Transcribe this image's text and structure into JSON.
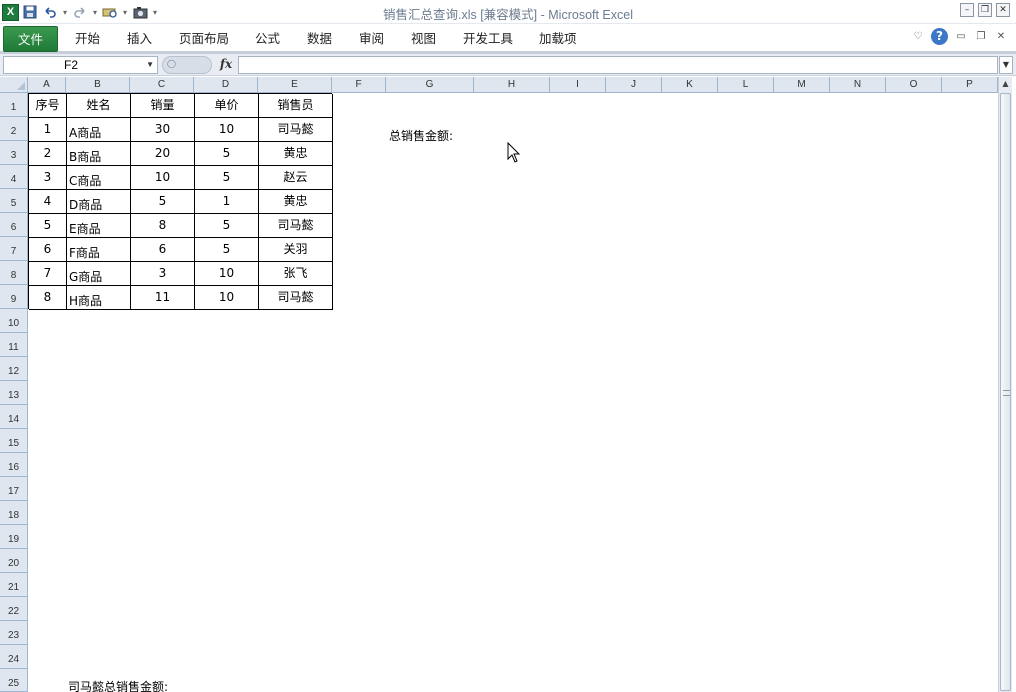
{
  "window": {
    "title": "销售汇总查询.xls  [兼容模式]  -  Microsoft Excel",
    "logo_letter": "X"
  },
  "ribbon": {
    "file_tab": "文件",
    "tabs": [
      "开始",
      "插入",
      "页面布局",
      "公式",
      "数据",
      "审阅",
      "视图",
      "开发工具",
      "加载项"
    ]
  },
  "formula_bar": {
    "name_box": "F2",
    "fx_label": "fx",
    "formula": ""
  },
  "sheet": {
    "columns": [
      "A",
      "B",
      "C",
      "D",
      "E",
      "F",
      "G",
      "H",
      "I",
      "J",
      "K",
      "L",
      "M",
      "N",
      "O",
      "P"
    ],
    "rows": [
      "1",
      "2",
      "3",
      "4",
      "5",
      "6",
      "7",
      "8",
      "9",
      "10",
      "11",
      "12",
      "13",
      "14",
      "15",
      "16",
      "17",
      "18",
      "19",
      "20",
      "21",
      "22",
      "23",
      "24",
      "25"
    ],
    "table_header": [
      "序号",
      "姓名",
      "销量",
      "单价",
      "销售员"
    ],
    "table_rows": [
      [
        "1",
        "A商品",
        "30",
        "10",
        "司马懿"
      ],
      [
        "2",
        "B商品",
        "20",
        "5",
        "黄忠"
      ],
      [
        "3",
        "C商品",
        "10",
        "5",
        "赵云"
      ],
      [
        "4",
        "D商品",
        "5",
        "1",
        "黄忠"
      ],
      [
        "5",
        "E商品",
        "8",
        "5",
        "司马懿"
      ],
      [
        "6",
        "F商品",
        "6",
        "5",
        "关羽"
      ],
      [
        "7",
        "G商品",
        "3",
        "10",
        "张飞"
      ],
      [
        "8",
        "H商品",
        "11",
        "10",
        "司马懿"
      ]
    ],
    "label_g2": "总销售金额:",
    "label_b25": "司马懿总销售金额:"
  }
}
